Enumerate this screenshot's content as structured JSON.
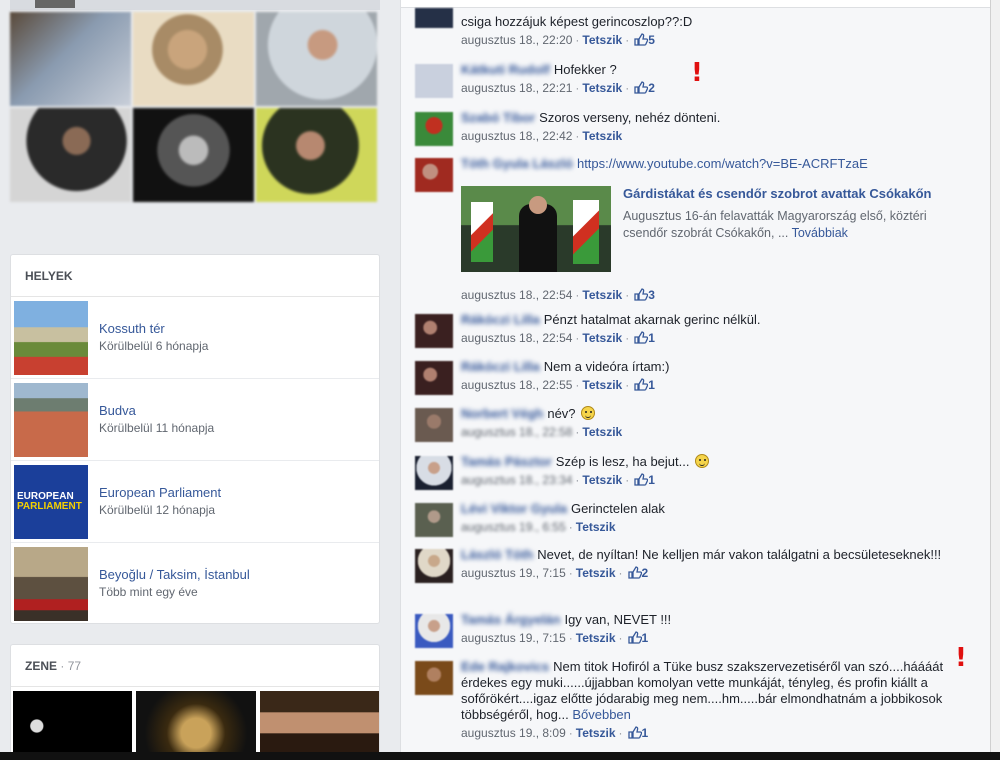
{
  "places": {
    "header": "HELYEK",
    "items": [
      {
        "name": "Kossuth tér",
        "time": "Körülbelül 6 hónapja"
      },
      {
        "name": "Budva",
        "time": "Körülbelül 11 hónapja"
      },
      {
        "name": "European Parliament",
        "time": "Körülbelül 12 hónapja",
        "logo_line1": "EUROPEAN",
        "logo_line2": "PARLIAMENT"
      },
      {
        "name": "Beyoğlu / Taksim, İstanbul",
        "time": "Több mint egy éve"
      }
    ]
  },
  "music": {
    "header": "ZENE",
    "count": "77"
  },
  "comments": [
    {
      "name": "",
      "text": "csiga hozzájuk képest gerincoszlop??:D",
      "time": "augusztus 18., 22:20",
      "like_label": "Tetszik",
      "likes": "5"
    },
    {
      "name": "Kátkuti Rudolf",
      "text": "Hofekker ?",
      "time": "augusztus 18., 22:21",
      "like_label": "Tetszik",
      "likes": "2"
    },
    {
      "name": "Szabó Tibor",
      "text": "Szoros verseny, nehéz dönteni.",
      "time": "augusztus 18., 22:42",
      "like_label": "Tetszik",
      "likes": ""
    },
    {
      "name": "Tóth Gyula László",
      "text": "https://www.youtube.com/watch?v=BE-ACRFTzaE",
      "time": "augusztus 18., 22:54",
      "like_label": "Tetszik",
      "likes": "3",
      "preview": {
        "title": "Gárdistákat és csendőr szobrot avattak Csókakőn",
        "desc": "Augusztus 16-án felavatták Magyarország első, köztéri csendőr szobrát Csókakőn, ...",
        "more": "Továbbiak"
      }
    },
    {
      "name": "Rákóczi Lilla",
      "text": "Pénzt hatalmat akarnak gerinc nélkül.",
      "time": "augusztus 18., 22:54",
      "like_label": "Tetszik",
      "likes": "1"
    },
    {
      "name": "Rákóczi Lilla",
      "text": "Nem a videóra írtam:)",
      "time": "augusztus 18., 22:55",
      "like_label": "Tetszik",
      "likes": "1"
    },
    {
      "name": "Norbert Végh",
      "text": "név?",
      "time": "augusztus 18., 22:58",
      "like_label": "Tetszik",
      "likes": ""
    },
    {
      "name": "Tamás Pásztor",
      "text": "Szép is lesz, ha bejut...",
      "time": "augusztus 18., 23:34",
      "like_label": "Tetszik",
      "likes": "1"
    },
    {
      "name": "Lévi Viktor Gyula",
      "text": "Gerinctelen alak",
      "time": "augusztus 19., 6:55",
      "like_label": "Tetszik",
      "likes": ""
    },
    {
      "name": "László Tóth",
      "text": "Nevet, de nyíltan! Ne kelljen már vakon találgatni a becsületeseknek!!!",
      "time": "augusztus 19., 7:15",
      "like_label": "Tetszik",
      "likes": "2"
    },
    {
      "name": "Tamás Árgyelán",
      "text": "Igy van, NEVET !!!",
      "time": "augusztus 19., 7:15",
      "like_label": "Tetszik",
      "likes": "1"
    },
    {
      "name": "Ede Rajkovics",
      "text": "Nem titok Hofiról a Tüke busz szakszervezetiséről van szó....háááát érdekes egy muki......újjabban komolyan vette munkáját, tényleg, és profin kiállt a sofőrökért....igaz előtte jódarabig meg nem....hm.....bár elmondhatnám a jobbikosok többségéről, hog...",
      "more": "Bővebben",
      "time": "augusztus 19., 8:09",
      "like_label": "Tetszik",
      "likes": "1"
    }
  ],
  "marks": {
    "exclamation": "!"
  },
  "colors": {
    "link": "#365899",
    "meta": "#616770",
    "bang": "#e01010"
  }
}
